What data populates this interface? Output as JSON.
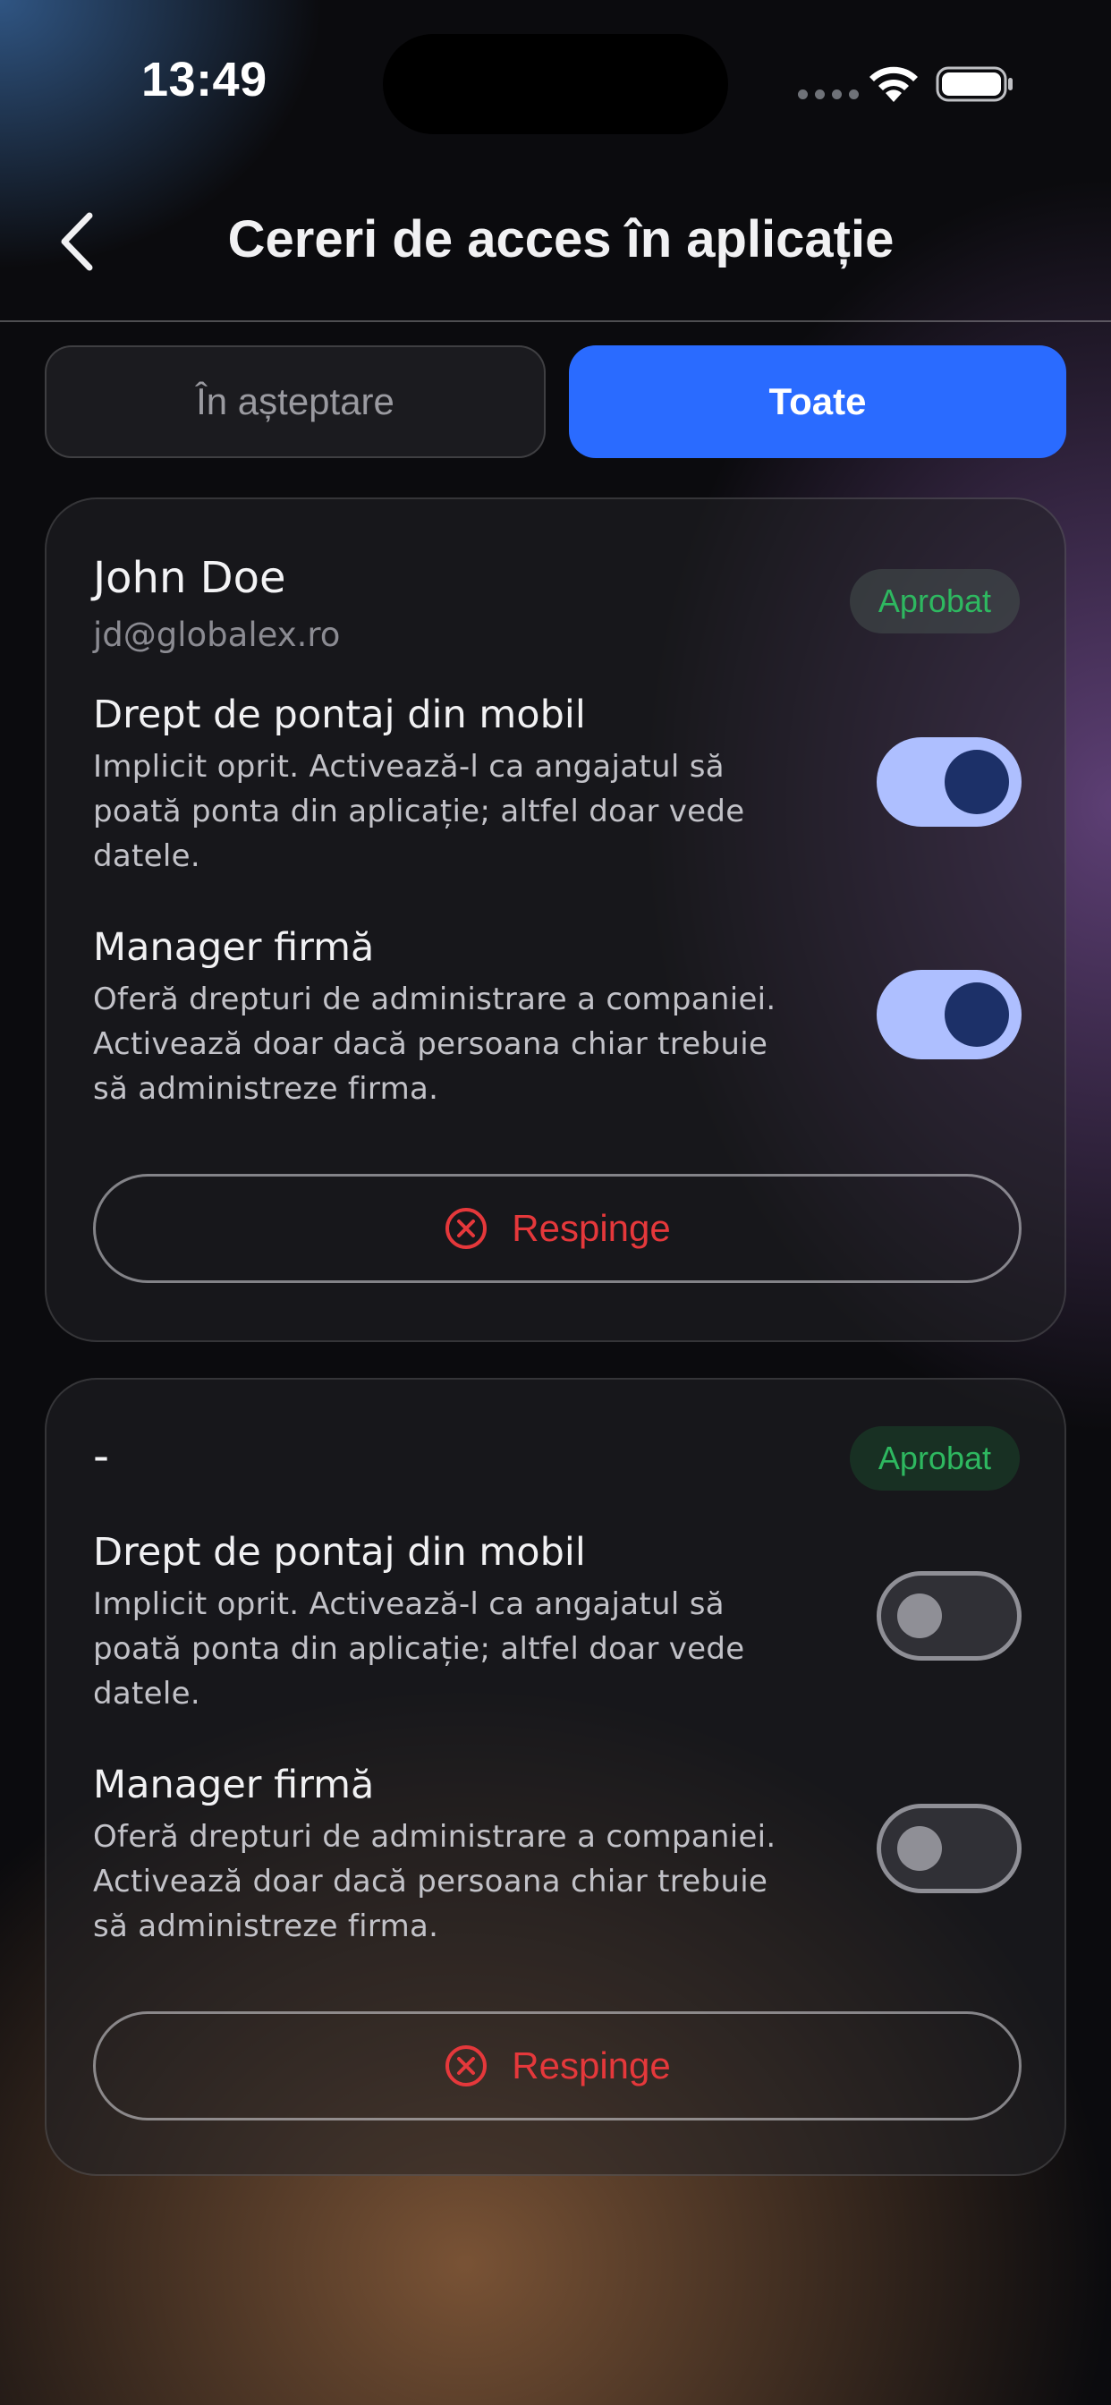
{
  "status_bar": {
    "time": "13:49"
  },
  "header": {
    "title": "Cereri de acces în aplicație"
  },
  "tabs": [
    {
      "label": "În așteptare",
      "active": false
    },
    {
      "label": "Toate",
      "active": true
    }
  ],
  "requests": [
    {
      "name": "John Doe",
      "email": "jd@globalex.ro",
      "status": "Aprobat",
      "permissions": [
        {
          "title": "Drept de pontaj din mobil",
          "description": "Implicit oprit. Activează-l ca angajatul să poată ponta din aplicație; altfel doar vede datele.",
          "enabled": true
        },
        {
          "title": "Manager firmă",
          "description": "Oferă drepturi de administrare a companiei. Activează doar dacă persoana chiar trebuie să administreze firma.",
          "enabled": true
        }
      ],
      "reject_label": "Respinge"
    },
    {
      "name": "-",
      "status": "Aprobat",
      "permissions": [
        {
          "title": "Drept de pontaj din mobil",
          "description": "Implicit oprit. Activează-l ca angajatul să poată ponta din aplicație; altfel doar vede datele.",
          "enabled": false
        },
        {
          "title": "Manager firmă",
          "description": "Oferă drepturi de administrare a companiei. Activează doar dacă persoana chiar trebuie să administreze firma.",
          "enabled": false
        }
      ],
      "reject_label": "Respinge"
    }
  ],
  "icons": {
    "back": "chevron-left-icon",
    "wifi": "wifi-icon",
    "battery": "battery-icon",
    "reject": "x-circle-icon"
  },
  "colors": {
    "accent": "#2a6bff",
    "approved": "#2eb860",
    "reject": "#e5383b",
    "toggle_on_track": "#aebfff",
    "toggle_on_knob": "#1c3068"
  }
}
